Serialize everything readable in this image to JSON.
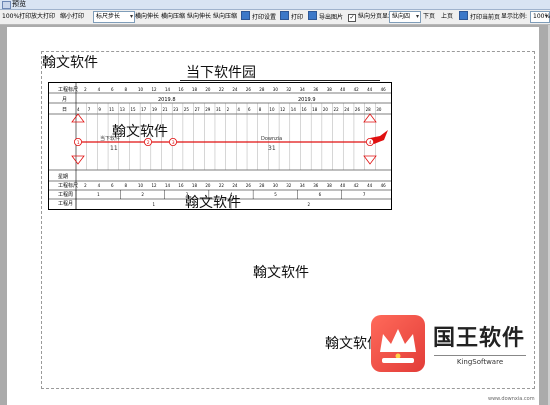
{
  "window": {
    "title": "预览"
  },
  "toolbar": {
    "zoom_full": "100%打印",
    "zoom_in": "放大打印",
    "zoom_out": "缩小打印",
    "ruler_select": "标尺步长",
    "h_stretch": "横向伸长",
    "h_compress": "横向压缩",
    "v_stretch": "纵向伸长",
    "v_compress": "纵向压缩",
    "print_setup": "打印设置",
    "print": "打印",
    "export_image": "导出图片",
    "page_split_label": "纵向分页显示",
    "orientation_select": "纵向四",
    "next_page": "下页",
    "prev_page": "上页",
    "print_current": "打印当前页",
    "display_ratio_label": "显示比例:",
    "display_ratio_value": "100%"
  },
  "document": {
    "watermark": "翰文软件",
    "chart_title": "当下软件园",
    "rows": {
      "schedule": "工程标尺",
      "month": "月",
      "day": "日",
      "weekday": "星期",
      "schedule_bottom": "工程标尺",
      "week": "工程周",
      "workmonth": "工程月"
    },
    "months": [
      "2019.8",
      "2019.9"
    ],
    "day_ticks": [
      "4",
      "7",
      "9",
      "11",
      "13",
      "15",
      "17",
      "19",
      "21",
      "23",
      "25",
      "27",
      "29",
      "31",
      "2",
      "4",
      "6",
      "8",
      "10",
      "12",
      "14",
      "16",
      "18",
      "20",
      "22",
      "24",
      "26",
      "28",
      "30"
    ],
    "schedule_ticks": [
      "2",
      "4",
      "6",
      "8",
      "10",
      "12",
      "14",
      "16",
      "18",
      "20",
      "22",
      "24",
      "26",
      "28",
      "30",
      "32",
      "34",
      "36",
      "38",
      "40",
      "42",
      "44",
      "46"
    ],
    "weeks": [
      "1",
      "2",
      "3",
      "4",
      "5",
      "6",
      "7"
    ],
    "months_bottom": [
      "1",
      "2"
    ],
    "tasks": [
      {
        "name": "当下软件",
        "duration": "11"
      },
      {
        "name": "Downzia",
        "duration": "31"
      }
    ],
    "node_labels": [
      "1",
      "2",
      "3",
      "4"
    ]
  },
  "branding": {
    "logo_text": "国王软件",
    "logo_sub": "KingSoftware",
    "url": "www.downxia.com"
  },
  "colors": {
    "critical_path": "#e01010",
    "logo_red": "#e84a40"
  }
}
